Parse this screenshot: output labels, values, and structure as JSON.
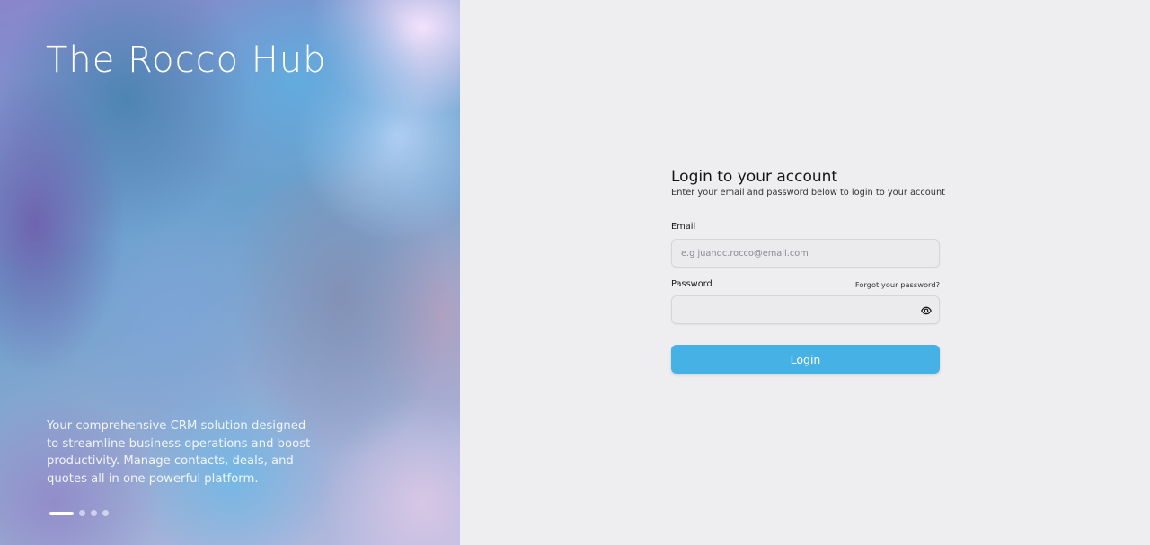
{
  "hero": {
    "title": "The Rocco Hub",
    "description": "Your comprehensive CRM solution designed to streamline business operations and boost productivity. Manage contacts, deals, and quotes all in one powerful platform.",
    "carousel": {
      "total_slides": 4,
      "active_slide": 1
    }
  },
  "login": {
    "title": "Login to your account",
    "subtitle": "Enter your email and password below to login to your account",
    "email_label": "Email",
    "email_placeholder": "e.g juandc.rocco@email.com",
    "email_value": "",
    "password_label": "Password",
    "password_value": "",
    "forgot_label": "Forgot your password?",
    "submit_label": "Login"
  },
  "icons": {
    "password_toggle": "eye-icon"
  },
  "colors": {
    "accent": "#45b1e4",
    "panel_background": "#eeeef0"
  }
}
